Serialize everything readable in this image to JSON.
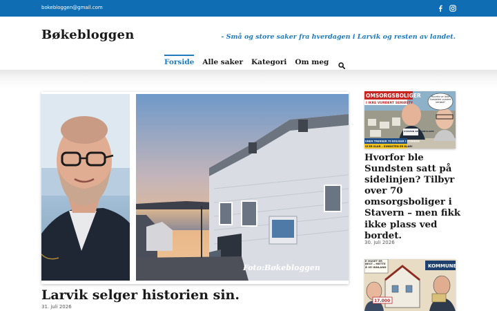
{
  "topbar": {
    "email": "bokebloggen@gmail.com",
    "social": [
      "facebook-icon",
      "instagram-icon"
    ],
    "bg_color": "#0f6db3"
  },
  "header": {
    "logo": "Bøkebloggen",
    "tagline": "- Små og store saker fra hverdagen i Larvik og resten av landet."
  },
  "nav": {
    "items": [
      "Forside",
      "Alle saker",
      "Kategori",
      "Om meg"
    ],
    "active": "Forside",
    "search_icon": "search-icon",
    "accent": "#1f7bbf"
  },
  "feature": {
    "title": "Larvik selger historien sin.",
    "date": "31. juli 2026",
    "image_caption": "Foto:Bøkebloggen"
  },
  "sidebar": {
    "posts": [
      {
        "title": "Hvorfor ble Sundsten satt på sidelinjen? Tilbyr over 70 omsorgsboliger i Stavern – men fikk ikke plass ved bordet.",
        "date": "30. juli 2026",
        "thumb_text": {
          "banner": "OMSORGSBOLIGER",
          "banner_sub": "I IKKE VURDERT SERIØSTY",
          "bubble": "Hvorfor er ikke Sundsten vurdert seriøst?",
          "sign": "STAVERN SENIORBOLIGER",
          "bottom1": "UNEN TRENGER 70 BOLIGER I STAVERN",
          "bottom2": "VI ER KLAR – SUNDSTEN ER KLAR!"
        }
      },
      {
        "title": "",
        "date": "",
        "thumb_text": {
          "left": "E HUSET ER BEST – METTE Å VE INNLAND",
          "right": "KOMMUNEN",
          "price": "17.000"
        }
      }
    ]
  }
}
